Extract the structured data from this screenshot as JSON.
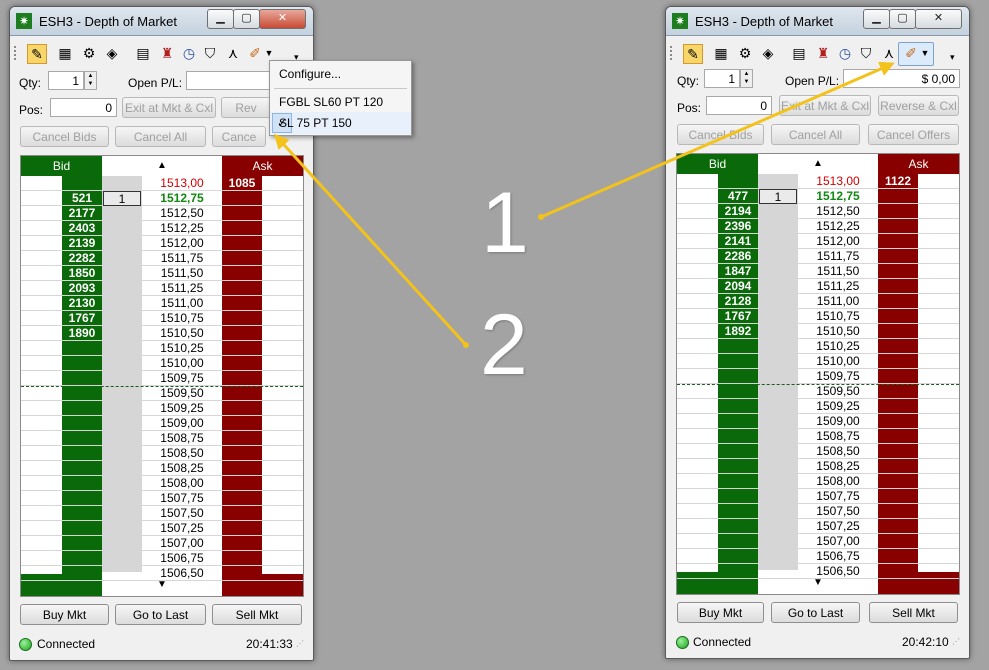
{
  "colors": {
    "bid": "#0a6a0a",
    "ask": "#880000",
    "last": "#118811",
    "high": "#d00000",
    "desktop": "#a3a3a3",
    "arrow": "#f3c21b"
  },
  "window1": {
    "title": "ESH3 - Depth of Market",
    "qty_label": "Qty:",
    "qty_value": "1",
    "open_pl_label": "Open P/L:",
    "open_pl_value": "",
    "pos_label": "Pos:",
    "pos_value": "0",
    "exit_button": "Exit at Mkt & Cxl",
    "reverse_button": "Rev",
    "cancel_bids": "Cancel Bids",
    "cancel_all": "Cancel All",
    "cancel_offers": "Cance",
    "bid_header": "Bid",
    "ask_header": "Ask",
    "rows": [
      {
        "price": "1513,00",
        "bid": "",
        "ask": "1085",
        "qty": "",
        "style": "hi"
      },
      {
        "price": "1512,75",
        "bid": "521",
        "ask": "",
        "qty": "1",
        "style": "last"
      },
      {
        "price": "1512,50",
        "bid": "2177",
        "ask": "",
        "qty": "",
        "style": ""
      },
      {
        "price": "1512,25",
        "bid": "2403",
        "ask": "",
        "qty": "",
        "style": ""
      },
      {
        "price": "1512,00",
        "bid": "2139",
        "ask": "",
        "qty": "",
        "style": ""
      },
      {
        "price": "1511,75",
        "bid": "2282",
        "ask": "",
        "qty": "",
        "style": ""
      },
      {
        "price": "1511,50",
        "bid": "1850",
        "ask": "",
        "qty": "",
        "style": ""
      },
      {
        "price": "1511,25",
        "bid": "2093",
        "ask": "",
        "qty": "",
        "style": ""
      },
      {
        "price": "1511,00",
        "bid": "2130",
        "ask": "",
        "qty": "",
        "style": ""
      },
      {
        "price": "1510,75",
        "bid": "1767",
        "ask": "",
        "qty": "",
        "style": ""
      },
      {
        "price": "1510,50",
        "bid": "1890",
        "ask": "",
        "qty": "",
        "style": ""
      },
      {
        "price": "1510,25",
        "bid": "",
        "ask": "",
        "qty": "",
        "style": ""
      },
      {
        "price": "1510,00",
        "bid": "",
        "ask": "",
        "qty": "",
        "style": ""
      },
      {
        "price": "1509,75",
        "bid": "",
        "ask": "",
        "qty": "",
        "style": ""
      },
      {
        "price": "1509,50",
        "bid": "",
        "ask": "",
        "qty": "",
        "style": ""
      },
      {
        "price": "1509,25",
        "bid": "",
        "ask": "",
        "qty": "",
        "style": ""
      },
      {
        "price": "1509,00",
        "bid": "",
        "ask": "",
        "qty": "",
        "style": ""
      },
      {
        "price": "1508,75",
        "bid": "",
        "ask": "",
        "qty": "",
        "style": ""
      },
      {
        "price": "1508,50",
        "bid": "",
        "ask": "",
        "qty": "",
        "style": ""
      },
      {
        "price": "1508,25",
        "bid": "",
        "ask": "",
        "qty": "",
        "style": ""
      },
      {
        "price": "1508,00",
        "bid": "",
        "ask": "",
        "qty": "",
        "style": ""
      },
      {
        "price": "1507,75",
        "bid": "",
        "ask": "",
        "qty": "",
        "style": ""
      },
      {
        "price": "1507,50",
        "bid": "",
        "ask": "",
        "qty": "",
        "style": ""
      },
      {
        "price": "1507,25",
        "bid": "",
        "ask": "",
        "qty": "",
        "style": ""
      },
      {
        "price": "1507,00",
        "bid": "",
        "ask": "",
        "qty": "",
        "style": ""
      },
      {
        "price": "1506,75",
        "bid": "",
        "ask": "",
        "qty": "",
        "style": ""
      },
      {
        "price": "1506,50",
        "bid": "",
        "ask": "",
        "qty": "",
        "style": ""
      }
    ],
    "buy_mkt": "Buy Mkt",
    "go_to_last": "Go to Last",
    "sell_mkt": "Sell Mkt",
    "status": "Connected",
    "time": "20:41:33",
    "menu": {
      "configure": "Configure...",
      "item1": "FGBL SL60 PT 120",
      "item2": "SL 75 PT 150"
    }
  },
  "window2": {
    "title": "ESH3 - Depth of Market",
    "qty_label": "Qty:",
    "qty_value": "1",
    "open_pl_label": "Open P/L:",
    "open_pl_value": "$ 0,00",
    "pos_label": "Pos:",
    "pos_value": "0",
    "exit_button": "Exit at Mkt & Cxl",
    "reverse_button": "Reverse & Cxl",
    "cancel_bids": "Cancel Bids",
    "cancel_all": "Cancel All",
    "cancel_offers": "Cancel Offers",
    "bid_header": "Bid",
    "ask_header": "Ask",
    "rows": [
      {
        "price": "1513,00",
        "bid": "",
        "ask": "1122",
        "qty": "",
        "style": "hi"
      },
      {
        "price": "1512,75",
        "bid": "477",
        "ask": "",
        "qty": "1",
        "style": "last"
      },
      {
        "price": "1512,50",
        "bid": "2194",
        "ask": "",
        "qty": "",
        "style": ""
      },
      {
        "price": "1512,25",
        "bid": "2396",
        "ask": "",
        "qty": "",
        "style": ""
      },
      {
        "price": "1512,00",
        "bid": "2141",
        "ask": "",
        "qty": "",
        "style": ""
      },
      {
        "price": "1511,75",
        "bid": "2286",
        "ask": "",
        "qty": "",
        "style": ""
      },
      {
        "price": "1511,50",
        "bid": "1847",
        "ask": "",
        "qty": "",
        "style": ""
      },
      {
        "price": "1511,25",
        "bid": "2094",
        "ask": "",
        "qty": "",
        "style": ""
      },
      {
        "price": "1511,00",
        "bid": "2128",
        "ask": "",
        "qty": "",
        "style": ""
      },
      {
        "price": "1510,75",
        "bid": "1767",
        "ask": "",
        "qty": "",
        "style": ""
      },
      {
        "price": "1510,50",
        "bid": "1892",
        "ask": "",
        "qty": "",
        "style": ""
      },
      {
        "price": "1510,25",
        "bid": "",
        "ask": "",
        "qty": "",
        "style": ""
      },
      {
        "price": "1510,00",
        "bid": "",
        "ask": "",
        "qty": "",
        "style": ""
      },
      {
        "price": "1509,75",
        "bid": "",
        "ask": "",
        "qty": "",
        "style": ""
      },
      {
        "price": "1509,50",
        "bid": "",
        "ask": "",
        "qty": "",
        "style": ""
      },
      {
        "price": "1509,25",
        "bid": "",
        "ask": "",
        "qty": "",
        "style": ""
      },
      {
        "price": "1509,00",
        "bid": "",
        "ask": "",
        "qty": "",
        "style": ""
      },
      {
        "price": "1508,75",
        "bid": "",
        "ask": "",
        "qty": "",
        "style": ""
      },
      {
        "price": "1508,50",
        "bid": "",
        "ask": "",
        "qty": "",
        "style": ""
      },
      {
        "price": "1508,25",
        "bid": "",
        "ask": "",
        "qty": "",
        "style": ""
      },
      {
        "price": "1508,00",
        "bid": "",
        "ask": "",
        "qty": "",
        "style": ""
      },
      {
        "price": "1507,75",
        "bid": "",
        "ask": "",
        "qty": "",
        "style": ""
      },
      {
        "price": "1507,50",
        "bid": "",
        "ask": "",
        "qty": "",
        "style": ""
      },
      {
        "price": "1507,25",
        "bid": "",
        "ask": "",
        "qty": "",
        "style": ""
      },
      {
        "price": "1507,00",
        "bid": "",
        "ask": "",
        "qty": "",
        "style": ""
      },
      {
        "price": "1506,75",
        "bid": "",
        "ask": "",
        "qty": "",
        "style": ""
      },
      {
        "price": "1506,50",
        "bid": "",
        "ask": "",
        "qty": "",
        "style": ""
      }
    ],
    "buy_mkt": "Buy Mkt",
    "go_to_last": "Go to Last",
    "sell_mkt": "Sell Mkt",
    "status": "Connected",
    "time": "20:42:10"
  },
  "callouts": {
    "one": "1",
    "two": "2"
  },
  "icons": {
    "title": "star-icon",
    "toolbar": [
      "pencil-icon",
      "calculator-icon",
      "gear-icon",
      "chart-icon",
      "calendar-icon",
      "book-icon",
      "clock-icon",
      "shield-icon",
      "network-icon",
      "brush-icon",
      "dropdown-arrow-icon",
      "overflow-icon"
    ]
  }
}
